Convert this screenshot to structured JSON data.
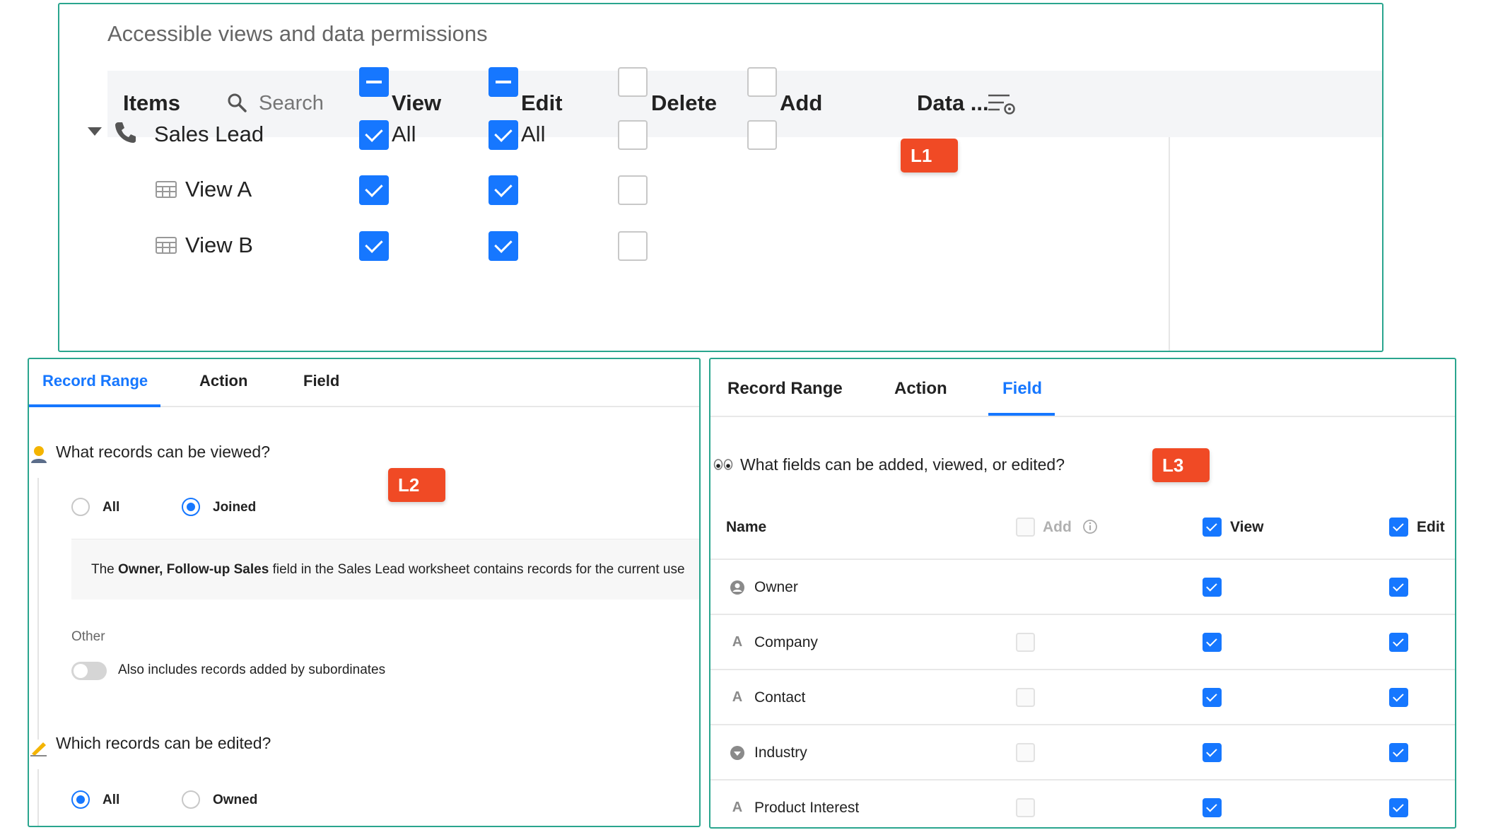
{
  "l1": {
    "badge": "L1",
    "title": "Accessible views and data permissions",
    "header": {
      "items_label": "Items",
      "search_placeholder": "Search",
      "view_label": "View",
      "edit_label": "Edit",
      "delete_label": "Delete",
      "add_label": "Add",
      "data_label": "Data ..."
    },
    "rows": [
      {
        "name": "Sales Lead",
        "view_text": "All",
        "edit_text": "All"
      },
      {
        "name": "View A"
      },
      {
        "name": "View B"
      }
    ]
  },
  "l2": {
    "badge": "L2",
    "tabs": [
      "Record Range",
      "Action",
      "Field"
    ],
    "active_tab": "Record Range",
    "q1": "What records can be viewed?",
    "q1_options": [
      "All",
      "Joined"
    ],
    "q1_selected": "Joined",
    "note_prefix": "The ",
    "note_bold": "Owner, Follow-up Sales",
    "note_suffix": " field in the Sales Lead worksheet contains records for the current use",
    "other_label": "Other",
    "toggle_label": "Also includes records added by subordinates",
    "toggle_on": false,
    "q2": "Which records can be edited?",
    "q2_options": [
      "All",
      "Owned"
    ],
    "q2_selected": "All"
  },
  "l3": {
    "badge": "L3",
    "tabs": [
      "Record Range",
      "Action",
      "Field"
    ],
    "active_tab": "Field",
    "question": "What fields can be added, viewed, or edited?",
    "columns": {
      "name": "Name",
      "add": "Add",
      "view": "View",
      "edit": "Edit"
    },
    "fields": [
      {
        "name": "Owner",
        "icon": "user-icon",
        "add": null,
        "view": true,
        "edit": true
      },
      {
        "name": "Company",
        "icon": "text-icon",
        "add": false,
        "view": true,
        "edit": true
      },
      {
        "name": "Contact",
        "icon": "text-icon",
        "add": false,
        "view": true,
        "edit": true
      },
      {
        "name": "Industry",
        "icon": "select-icon",
        "add": false,
        "view": true,
        "edit": true
      },
      {
        "name": "Product Interest",
        "icon": "text-icon",
        "add": false,
        "view": true,
        "edit": true
      }
    ]
  },
  "colors": {
    "accent": "#1677ff",
    "frame": "#2aa58e",
    "badge": "#f04a25"
  }
}
